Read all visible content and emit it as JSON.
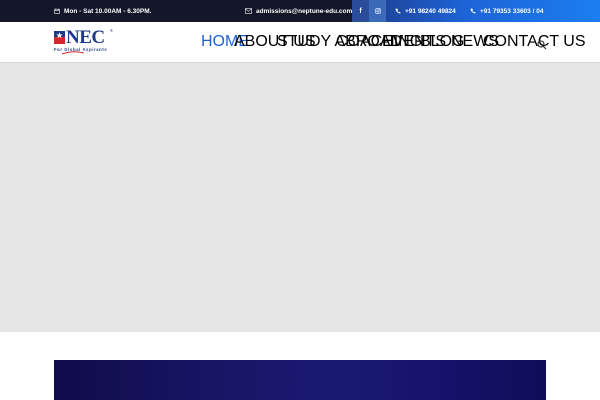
{
  "topbar": {
    "hours": "Mon - Sat 10.00AM - 6.30PM.",
    "email": "admissions@neptune-edu.com",
    "phone1": "+91 98240 49824",
    "phone2": "+91 79353 33603 / 04",
    "social": {
      "facebook": "f",
      "instagram": "ig"
    },
    "icons": [
      "calendar-icon",
      "envelope-icon",
      "facebook-icon",
      "instagram-icon",
      "phone-icon"
    ]
  },
  "logo": {
    "name": "NEC",
    "registered": "®",
    "tagline": "For Global Aspirants"
  },
  "nav": {
    "items": [
      {
        "label": "HOME",
        "active": true
      },
      {
        "label": "ABOUT US",
        "active": false
      },
      {
        "label": "STUDY ABROAD",
        "active": false
      },
      {
        "label": "COACHING",
        "active": false
      },
      {
        "label": "EVENTS",
        "active": false
      },
      {
        "label": "BLOG",
        "active": false
      },
      {
        "label": "NEWS",
        "active": false
      },
      {
        "label": "CONTACT US",
        "active": false
      }
    ],
    "search_icon": "search-icon"
  },
  "colors": {
    "topbar_bg": "#14162a",
    "accent_blue": "#1e63d6",
    "hero_bg": "#e6e6e6",
    "banner_navy": "#16135f"
  }
}
